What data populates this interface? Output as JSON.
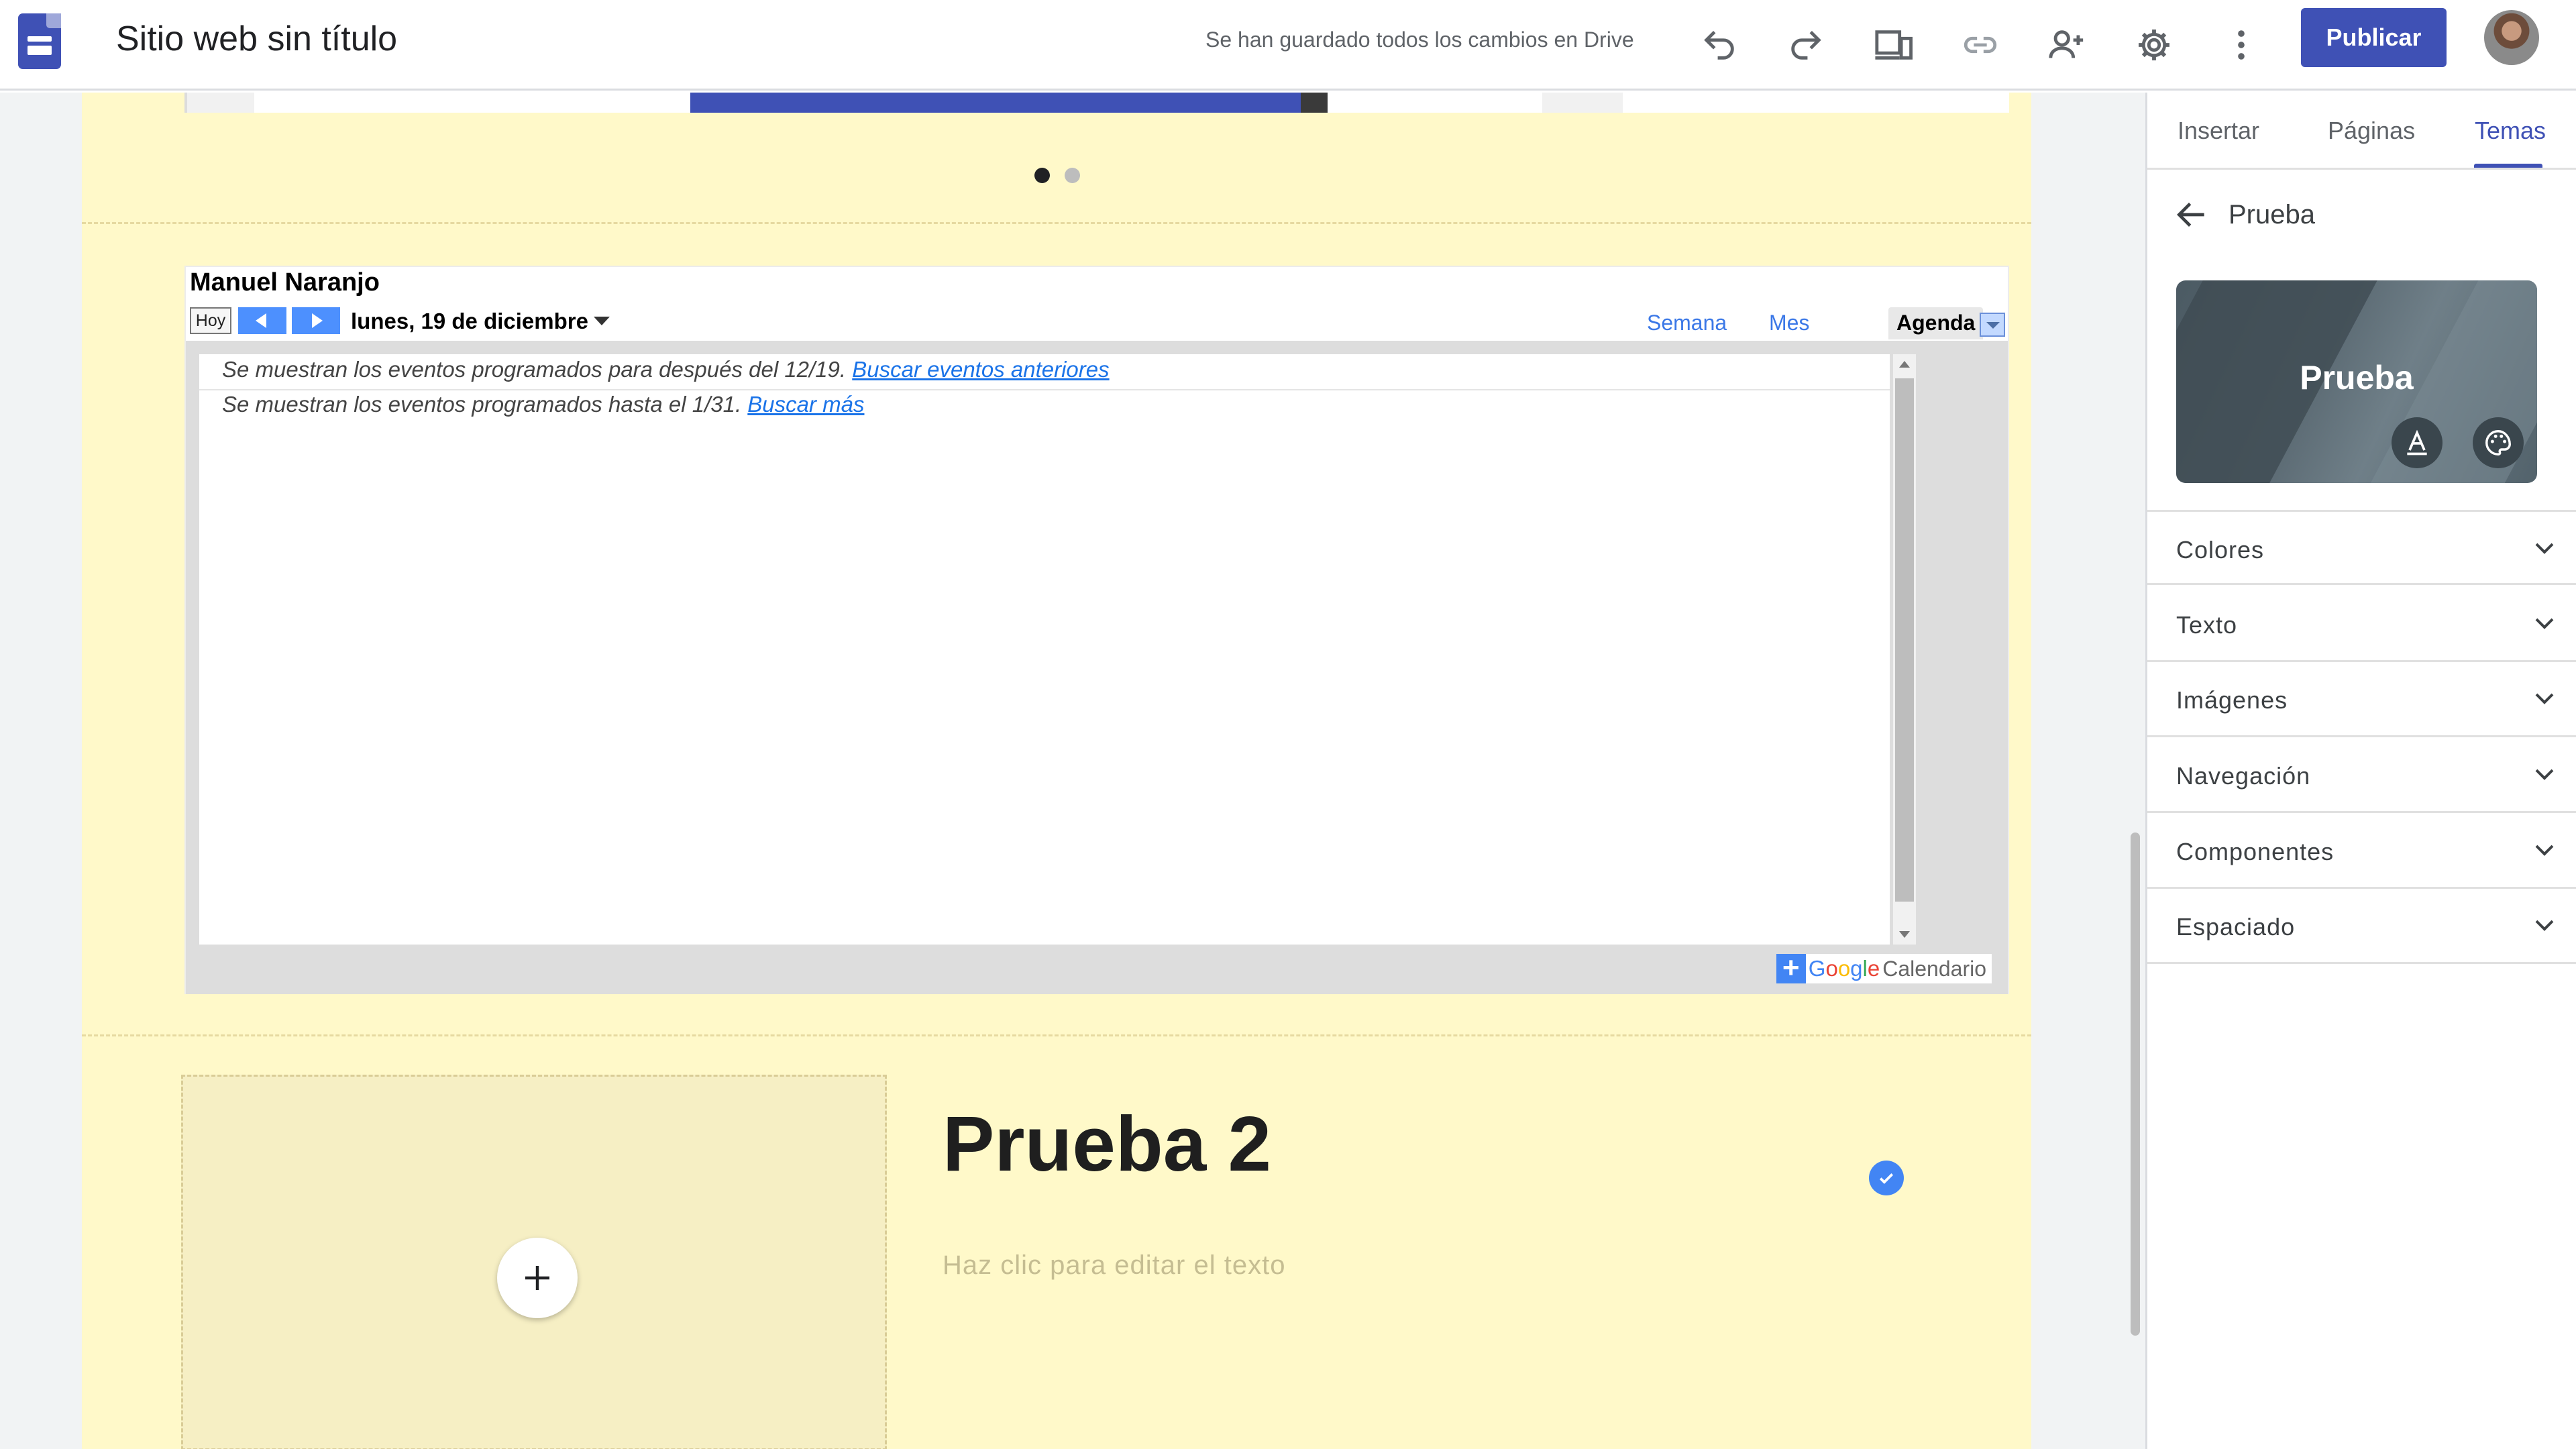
{
  "header": {
    "title": "Sitio web sin título",
    "save_status": "Se han guardado todos los cambios en Drive",
    "publish_label": "Publicar",
    "icons": [
      "undo-icon",
      "redo-icon",
      "preview-icon",
      "link-icon",
      "share-icon",
      "settings-icon",
      "more-icon"
    ]
  },
  "canvas": {
    "carousel_dots": {
      "count": 2,
      "active": 1
    },
    "calendar": {
      "owner": "Manuel Naranjo",
      "today_label": "Hoy",
      "date": "lunes, 19 de diciembre",
      "views": [
        "Semana",
        "Mes",
        "Agenda"
      ],
      "active_view": "Agenda",
      "note1_text": "Se muestran los eventos programados para después del 12/19.",
      "note1_link": "Buscar eventos anteriores",
      "note2_text": "Se muestran los eventos programados hasta el 1/31.",
      "note2_link": "Buscar más",
      "badge_plus": "+",
      "badge_google": [
        "G",
        "o",
        "o",
        "g",
        "l",
        "e"
      ],
      "badge_calendar": "Calendario"
    },
    "section": {
      "heading": "Prueba 2",
      "placeholder": "Haz clic para editar el texto",
      "add_image_symbol": "+"
    }
  },
  "panel": {
    "tabs": [
      "Insertar",
      "Páginas",
      "Temas"
    ],
    "active_tab": "Temas",
    "theme_name": "Prueba",
    "card_title": "Prueba",
    "sections": [
      "Colores",
      "Texto",
      "Imágenes",
      "Navegación",
      "Componentes",
      "Espaciado"
    ]
  },
  "colors": {
    "brand": "#3f51b5",
    "page_background": "#fff9c9",
    "calendar_blue": "#4d90fe"
  }
}
